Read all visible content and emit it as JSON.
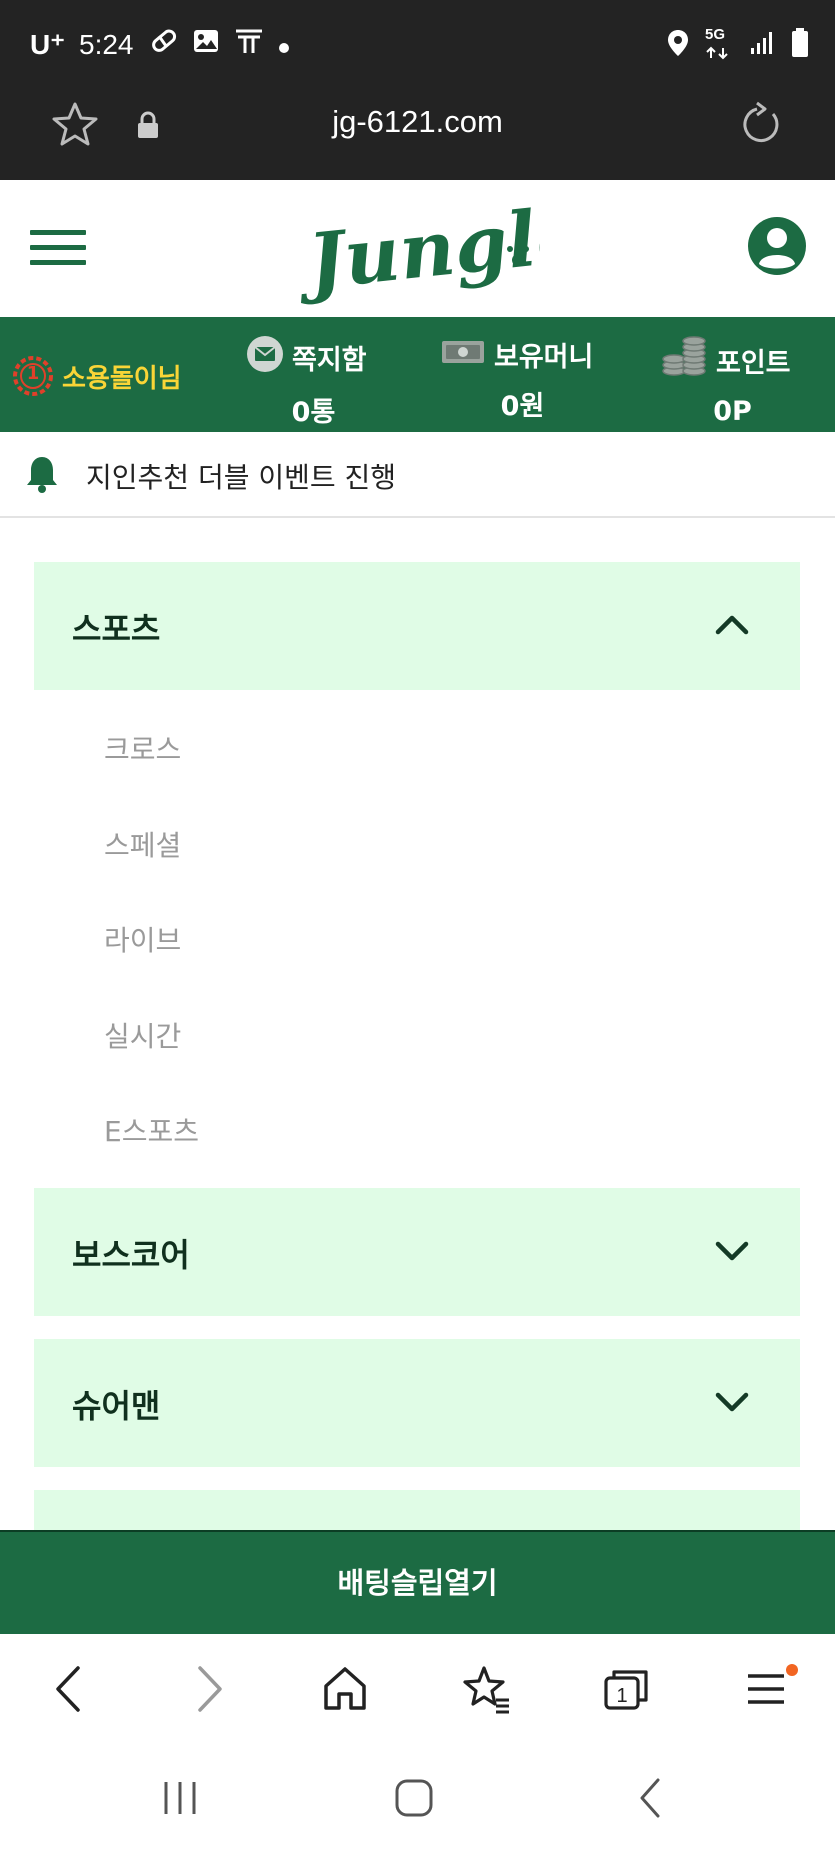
{
  "status_bar": {
    "carrier": "U⁺",
    "time": "5:24",
    "network": "5G"
  },
  "browser": {
    "url": "jg-6121.com"
  },
  "header": {
    "logo_text": "Jungle"
  },
  "user_bar": {
    "level_badge": "1",
    "username": "소용돌이님",
    "stats": [
      {
        "label": "쪽지함",
        "value": "0통"
      },
      {
        "label": "보유머니",
        "value": "0원"
      },
      {
        "label": "포인트",
        "value": "0P"
      }
    ]
  },
  "notice": {
    "text": "지인추천 더블 이벤트 진행"
  },
  "menu": {
    "sections": [
      {
        "title": "스포츠",
        "expanded": true
      },
      {
        "title": "보스코어",
        "expanded": false
      },
      {
        "title": "슈어맨",
        "expanded": false
      }
    ],
    "sports_items": [
      "크로스",
      "스페셜",
      "라이브",
      "실시간",
      "E스포츠"
    ]
  },
  "betting_slip": {
    "label": "배팅슬립열기"
  },
  "colors": {
    "brand_green": "#1c6b43",
    "accordion_bg": "#e0fce6",
    "username_yellow": "#f9d537",
    "badge_red": "#e0402a",
    "notification_dot": "#f26522"
  }
}
